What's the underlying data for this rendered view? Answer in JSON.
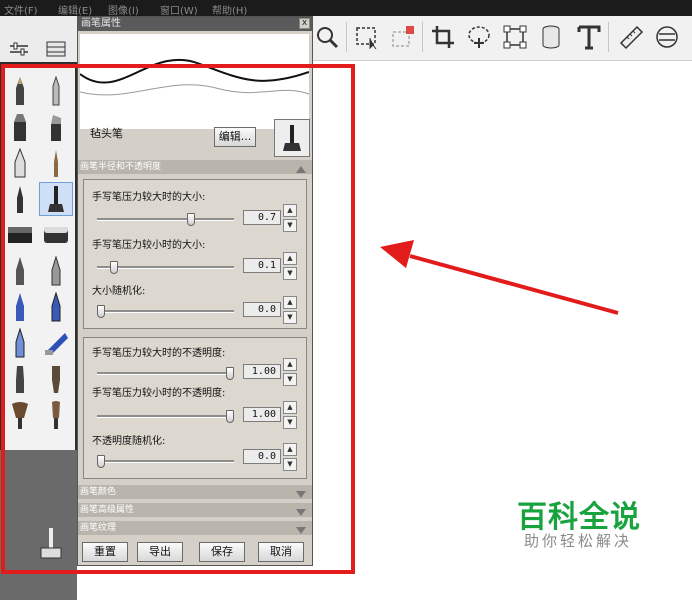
{
  "menubar": {
    "items": [
      "文件(F)",
      "编辑(E)",
      "图像(I)",
      "窗口(W)",
      "帮助(H)"
    ]
  },
  "toolbar": {
    "tools": [
      "search-icon",
      "marquee-select-icon",
      "marquee-add-icon",
      "crop-icon",
      "lasso-icon",
      "transform-icon",
      "cylinder-icon",
      "text-icon",
      "ruler-icon",
      "symmetry-icon"
    ]
  },
  "panel": {
    "title": "画笔属性",
    "close": "x",
    "brush_name": "毡头笔",
    "edit_button": "编辑...",
    "section_size_opacity": "画笔半径和不透明度",
    "size_group": {
      "max_pressure_size_label": "手写笔压力较大时的大小:",
      "max_pressure_size_value": "0.7",
      "min_pressure_size_label": "手写笔压力较小时的大小:",
      "min_pressure_size_value": "0.1",
      "size_random_label": "大小随机化:",
      "size_random_value": "0.0"
    },
    "opacity_group": {
      "max_pressure_opacity_label": "手写笔压力较大时的不透明度:",
      "max_pressure_opacity_value": "1.00",
      "min_pressure_opacity_label": "手写笔压力较小时的不透明度:",
      "min_pressure_opacity_value": "1.00",
      "opacity_random_label": "不透明度随机化:",
      "opacity_random_value": "0.0"
    },
    "section_color": "画笔颜色",
    "section_advanced": "画笔高级属性",
    "section_texture": "画笔纹理",
    "buttons": {
      "reset": "重置",
      "export": "导出",
      "save": "保存",
      "cancel": "取消"
    }
  },
  "slider_levels": {
    "max_size": 0.7,
    "min_size": 0.1,
    "size_random": 0.0,
    "max_opacity": 1.0,
    "min_opacity": 1.0,
    "opacity_random": 0.0
  },
  "watermark": {
    "title": "百科全说",
    "subtitle": "助你轻松解决"
  },
  "colors": {
    "annotation_red": "#e21b1b",
    "watermark_green": "#19a33f",
    "panel_bg": "#d4d0c8"
  }
}
